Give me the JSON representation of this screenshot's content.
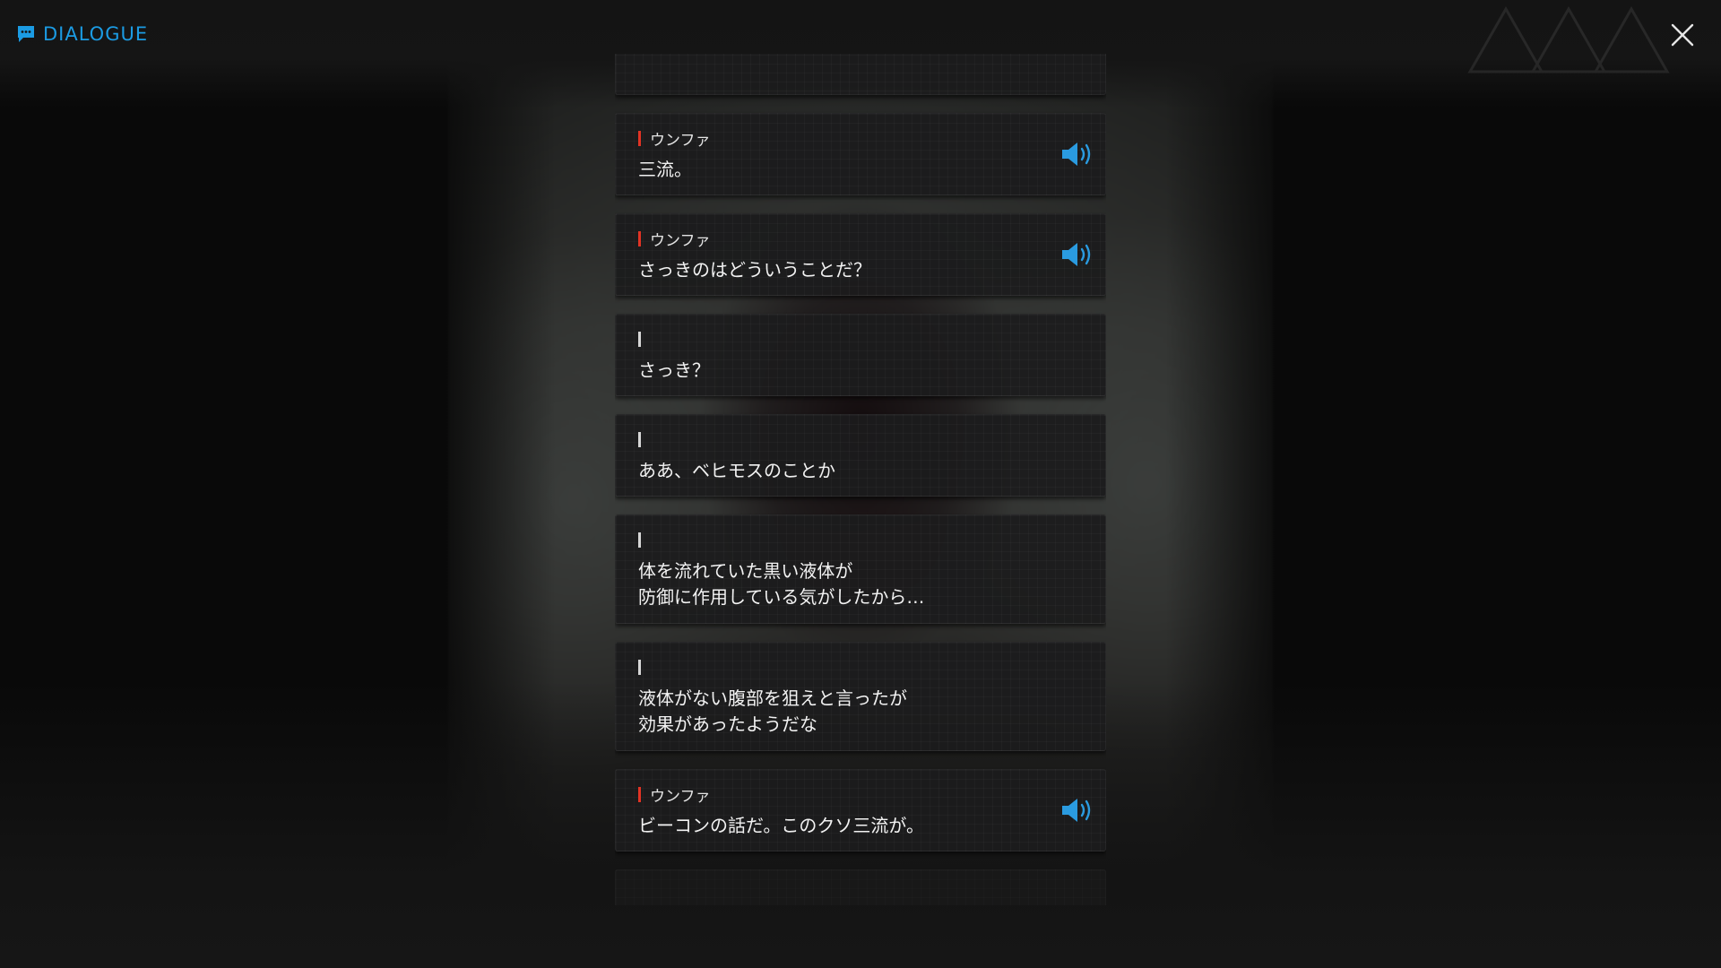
{
  "header": {
    "title": "DIALOGUE",
    "accent_color": "#1b9be3",
    "icon": "chat-bubble-icon"
  },
  "controls": {
    "close_icon": "close-icon",
    "voice_icon": "speaker-volume-icon"
  },
  "speaker_colors": {
    "npc": "#e23324",
    "player": "#d6d6d6"
  },
  "dialogue": [
    {
      "speaker": "ウンファ",
      "text": "三流。",
      "has_voice": true
    },
    {
      "speaker": "ウンファ",
      "text": "さっきのはどういうことだ？",
      "has_voice": true
    },
    {
      "speaker": "",
      "text": "さっき？",
      "has_voice": false
    },
    {
      "speaker": "",
      "text": "ああ、ベヒモスのことか",
      "has_voice": false
    },
    {
      "speaker": "",
      "text": "体を流れていた黒い液体が\n防御に作用している気がしたから…",
      "has_voice": false
    },
    {
      "speaker": "",
      "text": "液体がない腹部を狙えと言ったが\n効果があったようだな",
      "has_voice": false
    },
    {
      "speaker": "ウンファ",
      "text": "ビーコンの話だ。このクソ三流が。",
      "has_voice": true
    }
  ]
}
